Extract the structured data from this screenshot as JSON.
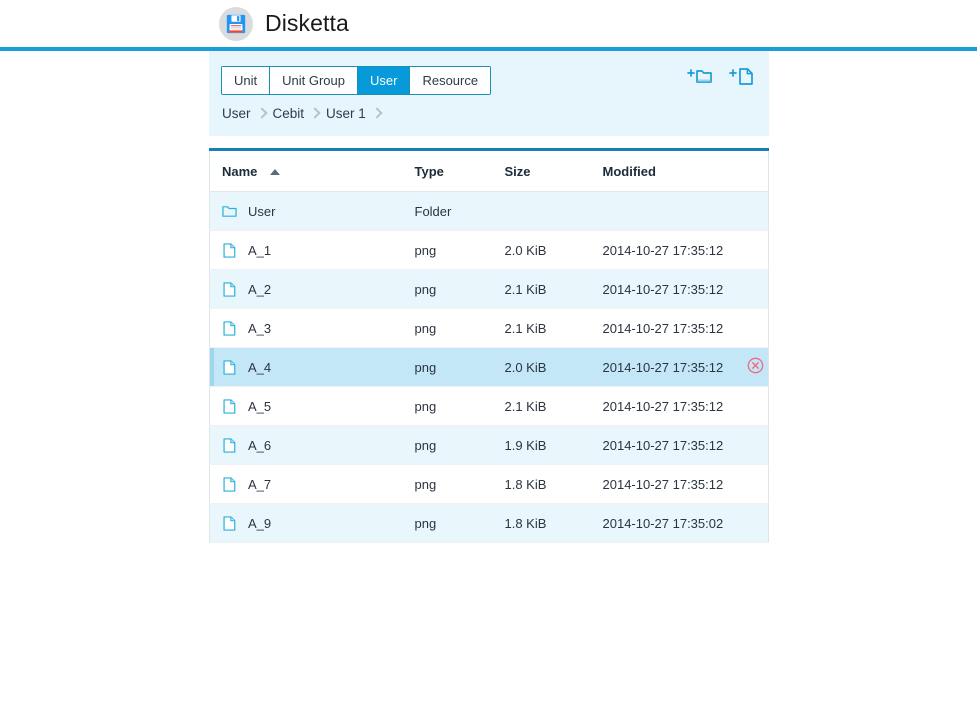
{
  "app": {
    "title": "Disketta",
    "logo_icon": "floppy-disk-icon",
    "accent_color": "#1b9dd9"
  },
  "toolbar": {
    "tabs": [
      {
        "label": "Unit",
        "active": false
      },
      {
        "label": "Unit Group",
        "active": false
      },
      {
        "label": "User",
        "active": true
      },
      {
        "label": "Resource",
        "active": false
      }
    ],
    "actions": [
      {
        "name": "new-folder-icon",
        "label": "New Folder"
      },
      {
        "name": "new-file-icon",
        "label": "New File"
      }
    ],
    "breadcrumb": [
      "User",
      "Cebit",
      "User 1"
    ]
  },
  "table": {
    "columns": [
      "Name",
      "Type",
      "Size",
      "Modified"
    ],
    "sort": {
      "column": "Name",
      "direction": "asc"
    },
    "rows": [
      {
        "icon": "folder-icon",
        "name": "User",
        "type": "Folder",
        "size": "",
        "modified": "",
        "stripe": "alt",
        "selected": false
      },
      {
        "icon": "file-icon",
        "name": "A_1",
        "type": "png",
        "size": "2.0 KiB",
        "modified": "2014-10-27 17:35:12",
        "stripe": "plain",
        "selected": false
      },
      {
        "icon": "file-icon",
        "name": "A_2",
        "type": "png",
        "size": "2.1 KiB",
        "modified": "2014-10-27 17:35:12",
        "stripe": "alt",
        "selected": false
      },
      {
        "icon": "file-icon",
        "name": "A_3",
        "type": "png",
        "size": "2.1 KiB",
        "modified": "2014-10-27 17:35:12",
        "stripe": "plain",
        "selected": false
      },
      {
        "icon": "file-icon",
        "name": "A_4",
        "type": "png",
        "size": "2.0 KiB",
        "modified": "2014-10-27 17:35:12",
        "stripe": "hover",
        "selected": true
      },
      {
        "icon": "file-icon",
        "name": "A_5",
        "type": "png",
        "size": "2.1 KiB",
        "modified": "2014-10-27 17:35:12",
        "stripe": "plain",
        "selected": false
      },
      {
        "icon": "file-icon",
        "name": "A_6",
        "type": "png",
        "size": "1.9 KiB",
        "modified": "2014-10-27 17:35:12",
        "stripe": "alt",
        "selected": false
      },
      {
        "icon": "file-icon",
        "name": "A_7",
        "type": "png",
        "size": "1.8 KiB",
        "modified": "2014-10-27 17:35:12",
        "stripe": "plain",
        "selected": false
      },
      {
        "icon": "file-icon",
        "name": "A_9",
        "type": "png",
        "size": "1.8 KiB",
        "modified": "2014-10-27 17:35:02",
        "stripe": "alt",
        "selected": false
      }
    ],
    "row_action_icon": "delete-circle-icon"
  }
}
